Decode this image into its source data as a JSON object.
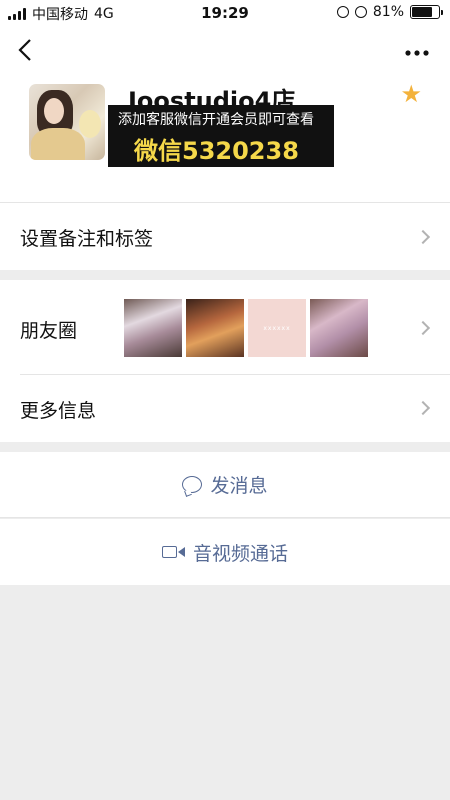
{
  "status_bar": {
    "carrier": "中国移动",
    "network": "4G",
    "time": "19:29",
    "battery_text": "81%",
    "battery_level": 0.81
  },
  "nav": {
    "back_icon": "chevron-left-icon",
    "more_icon": "more-dots-icon"
  },
  "profile": {
    "name": "Joostudio4店",
    "promo_line1": "添加客服微信开通会员即可查看",
    "promo_line2": "微信5320238",
    "star_color": "#f3b23c"
  },
  "rows": {
    "remark": "设置备注和标签",
    "moments": "朋友圈",
    "moments_thumb_text": "xxxxxx",
    "more_info": "更多信息"
  },
  "actions": {
    "message": "发消息",
    "call": "音视频通话",
    "accent_color": "#576b95"
  }
}
